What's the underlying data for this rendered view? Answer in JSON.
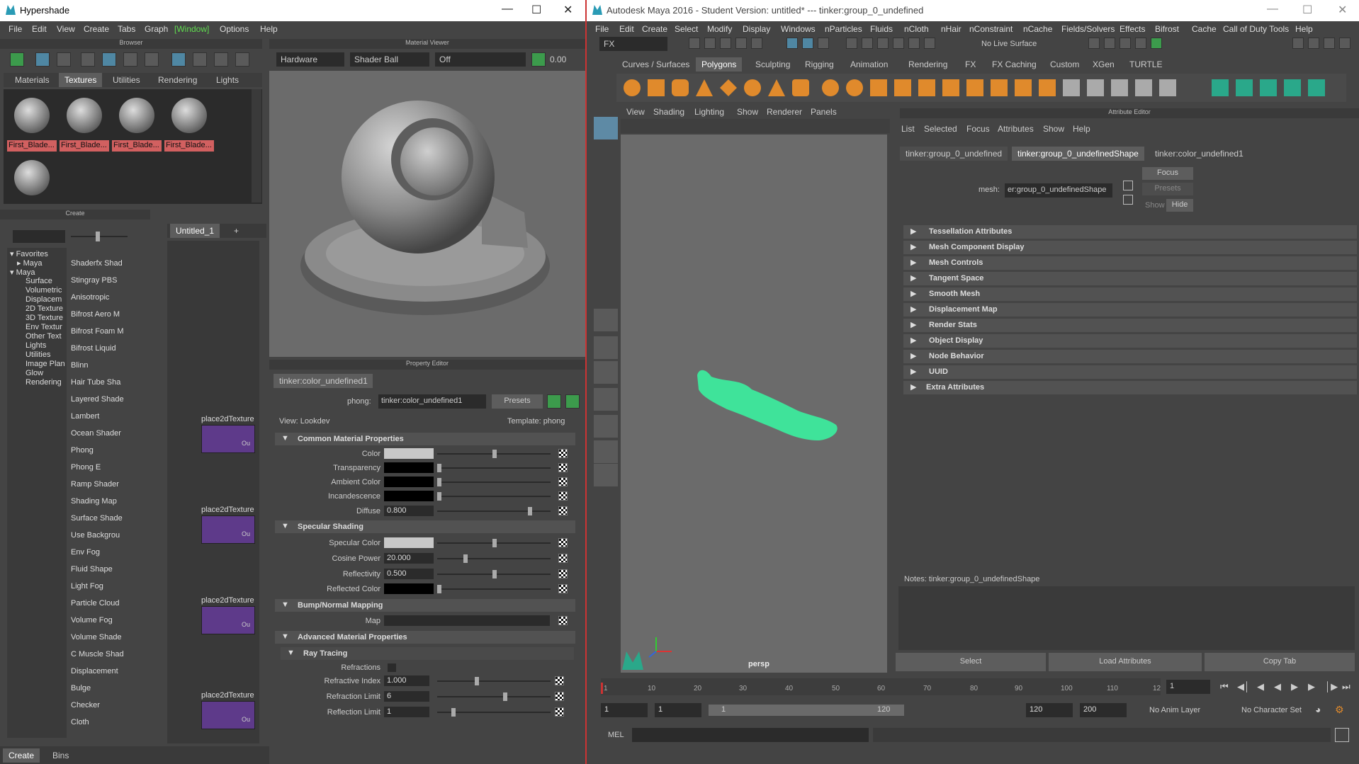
{
  "hypershade": {
    "title": "Hypershade",
    "menu": [
      "File",
      "Edit",
      "View",
      "Create",
      "Tabs",
      "Graph",
      "[Window]",
      "Options",
      "Help"
    ],
    "browser": {
      "panel_title": "Browser",
      "tabs": [
        "Materials",
        "Textures",
        "Utilities",
        "Rendering",
        "Lights"
      ],
      "active_tab": "Textures",
      "swatches": [
        "First_Blade...",
        "First_Blade...",
        "First_Blade...",
        "First_Blade..."
      ]
    },
    "material_viewer": {
      "panel_title": "Material Viewer",
      "renderer": "Hardware",
      "shape": "Shader Ball",
      "env": "Off",
      "exposure": "0.00"
    },
    "create": {
      "panel_title": "Create",
      "tree": [
        "Favorites",
        "Maya",
        "Maya",
        "Surface",
        "Volumetric",
        "Displacem",
        "2D Texture",
        "3D Texture",
        "Env Textur",
        "Other Text",
        "Lights",
        "Utilities",
        "Image Plan",
        "Glow",
        "Rendering"
      ],
      "nodes": [
        "Shaderfx Shad",
        "Stingray PBS",
        "Anisotropic",
        "Bifrost Aero M",
        "Bifrost Foam M",
        "Bifrost Liquid",
        "Blinn",
        "Hair Tube Sha",
        "Layered Shade",
        "Lambert",
        "Ocean Shader",
        "Phong",
        "Phong E",
        "Ramp Shader",
        "Shading Map",
        "Surface Shade",
        "Use Backgrou",
        "Env Fog",
        "Fluid Shape",
        "Light Fog",
        "Particle Cloud",
        "Volume Fog",
        "Volume Shade",
        "C Muscle Shad",
        "Displacement",
        "Bulge",
        "Checker",
        "Cloth"
      ],
      "bottom_tabs": [
        "Create",
        "Bins"
      ]
    },
    "graph": {
      "tab": "Untitled_1",
      "add": "+",
      "nodes": [
        "place2dTexture",
        "place2dTexture",
        "place2dTexture",
        "place2dTexture"
      ],
      "node_port": "Ou"
    },
    "property_editor": {
      "panel_title": "Property Editor",
      "tab": "tinker:color_undefined1",
      "type_label": "phong:",
      "name": "tinker:color_undefined1",
      "presets": "Presets",
      "view": "View: Lookdev",
      "template": "Template: phong",
      "sections": {
        "common": "Common Material Properties",
        "specular": "Specular Shading",
        "bump": "Bump/Normal Mapping",
        "advanced": "Advanced Material Properties",
        "ray": "Ray Tracing"
      },
      "rows": {
        "color": "Color",
        "transparency": "Transparency",
        "ambient": "Ambient Color",
        "incandescence": "Incandescence",
        "diffuse": "Diffuse",
        "diffuse_val": "0.800",
        "spec_color": "Specular Color",
        "cosine": "Cosine Power",
        "cosine_val": "20.000",
        "reflectivity": "Reflectivity",
        "reflectivity_val": "0.500",
        "reflected": "Reflected Color",
        "map": "Map",
        "refractions": "Refractions",
        "refr_index": "Refractive Index",
        "refr_index_val": "1.000",
        "refr_limit": "Refraction Limit",
        "refr_limit_val": "6",
        "refl_limit": "Reflection Limit",
        "refl_limit_val": "1"
      }
    }
  },
  "maya": {
    "title": "Autodesk Maya 2016 - Student Version: untitled*   ---   tinker:group_0_undefined",
    "menu": [
      "File",
      "Edit",
      "Create",
      "Select",
      "Modify",
      "Display",
      "Windows",
      "nParticles",
      "Fluids",
      "nCloth",
      "nHair",
      "nConstraint",
      "nCache",
      "Fields/Solvers",
      "Effects",
      "Bifrost",
      "Cache",
      "Call of Duty Tools",
      "Help"
    ],
    "mode": "FX",
    "live_surface": "No Live Surface",
    "shelf_tabs": [
      "Curves / Surfaces",
      "Polygons",
      "Sculpting",
      "Rigging",
      "Animation",
      "Rendering",
      "FX",
      "FX Caching",
      "Custom",
      "XGen",
      "TURTLE"
    ],
    "active_shelf": "Polygons",
    "viewport": {
      "menu": [
        "View",
        "Shading",
        "Lighting",
        "Show",
        "Renderer",
        "Panels"
      ],
      "camera": "persp",
      "mesh_color": "#3fe39a"
    },
    "attr_editor": {
      "panel_title": "Attribute Editor",
      "menu": [
        "List",
        "Selected",
        "Focus",
        "Attributes",
        "Show",
        "Help"
      ],
      "tabs": [
        "tinker:group_0_undefined",
        "tinker:group_0_undefinedShape",
        "tinker:color_undefined1"
      ],
      "mesh_label": "mesh:",
      "mesh_value": "er:group_0_undefinedShape",
      "focus": "Focus",
      "presets": "Presets",
      "show": "Show",
      "hide": "Hide",
      "sections": [
        "Tessellation Attributes",
        "Mesh Component Display",
        "Mesh Controls",
        "Tangent Space",
        "Smooth Mesh",
        "Displacement Map",
        "Render Stats",
        "Object Display",
        "Node Behavior",
        "UUID",
        "Extra Attributes"
      ],
      "notes": "Notes:  tinker:group_0_undefinedShape",
      "buttons": [
        "Select",
        "Load Attributes",
        "Copy Tab"
      ]
    },
    "timeline": {
      "ticks": [
        "10",
        "20",
        "30",
        "40",
        "50",
        "60",
        "70",
        "80",
        "90",
        "100",
        "110",
        "12"
      ],
      "start_tick": "1",
      "current_frame": "1",
      "range_start": "1",
      "range_inner_start": "1",
      "slider_start": "1",
      "slider_end": "120",
      "end": "120",
      "anim_end": "200",
      "anim_layer": "No Anim Layer",
      "char_set": "No Character Set"
    },
    "command_line": "MEL"
  }
}
